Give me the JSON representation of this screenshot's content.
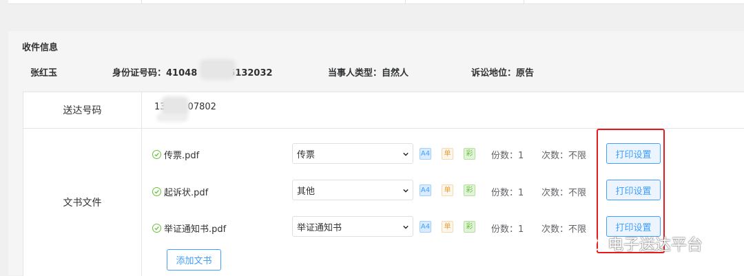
{
  "recipient": {
    "section_title": "收件信息",
    "name": "张红玉",
    "id_label": "身份证号码：",
    "id_prefix": "41048",
    "id_suffix": "5132032",
    "party_type_label": "当事人类型：",
    "party_type": "自然人",
    "litigation_label": "诉讼地位：",
    "litigation_status": "原告"
  },
  "delivery": {
    "number_label": "送达号码",
    "number_prefix": "13",
    "number_suffix": "07802"
  },
  "documents": {
    "label": "文书文件",
    "files": [
      {
        "name": "传票.pdf",
        "type": "传票",
        "copies": "份数：1",
        "times": "次数：不限",
        "print_label": "打印设置"
      },
      {
        "name": "起诉状.pdf",
        "type": "其他",
        "copies": "份数：1",
        "times": "次数：不限",
        "print_label": "打印设置"
      },
      {
        "name": "举证通知书.pdf",
        "type": "举证通知书",
        "copies": "份数：1",
        "times": "次数：不限",
        "print_label": "打印设置"
      }
    ],
    "tags": {
      "a4": "A4",
      "single": "单",
      "color": "彩"
    },
    "add_label": "添加文书"
  },
  "watermark": "电子送达平台",
  "colors": {
    "primary": "#409eff",
    "success": "#67c23a",
    "warning": "#e6a23c",
    "highlight": "#e8191b"
  }
}
